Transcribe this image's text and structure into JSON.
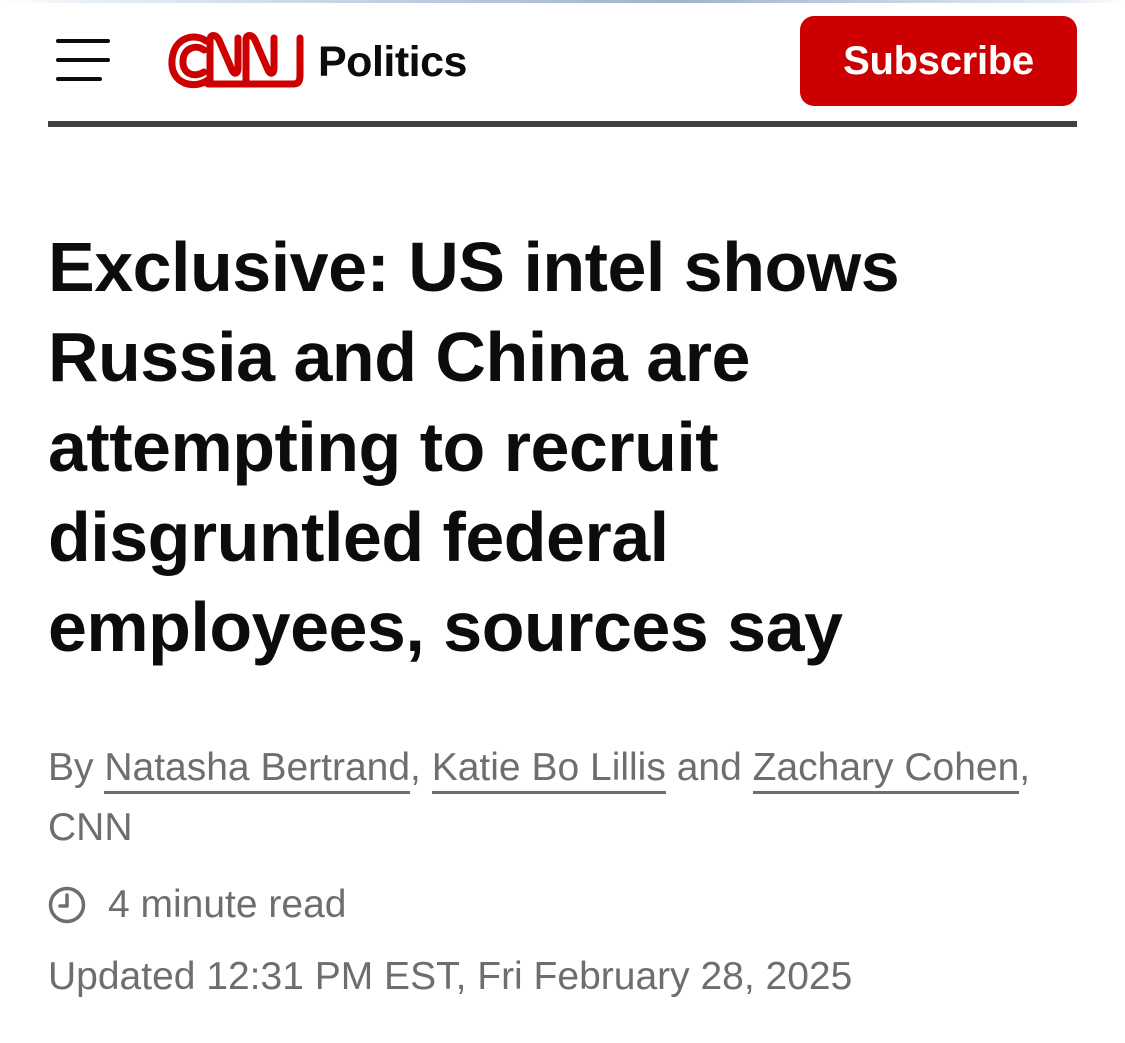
{
  "header": {
    "menu_icon": "hamburger-menu-icon",
    "logo_text": "CNN",
    "section": "Politics",
    "subscribe_label": "Subscribe",
    "brand_color": "#cc0000"
  },
  "article": {
    "headline": "Exclusive: US intel shows Russia and China are attempting to recruit disgruntled federal employees, sources say",
    "byline": {
      "prefix": "By",
      "authors": [
        "Natasha Bertrand",
        "Katie Bo Lillis",
        "Zachary Cohen"
      ],
      "separator": ",",
      "conjunction": "and",
      "outlet": ", CNN"
    },
    "read_time_icon": "clock-icon",
    "read_time": "4 minute read",
    "updated": "Updated 12:31 PM EST, Fri February 28, 2025"
  }
}
